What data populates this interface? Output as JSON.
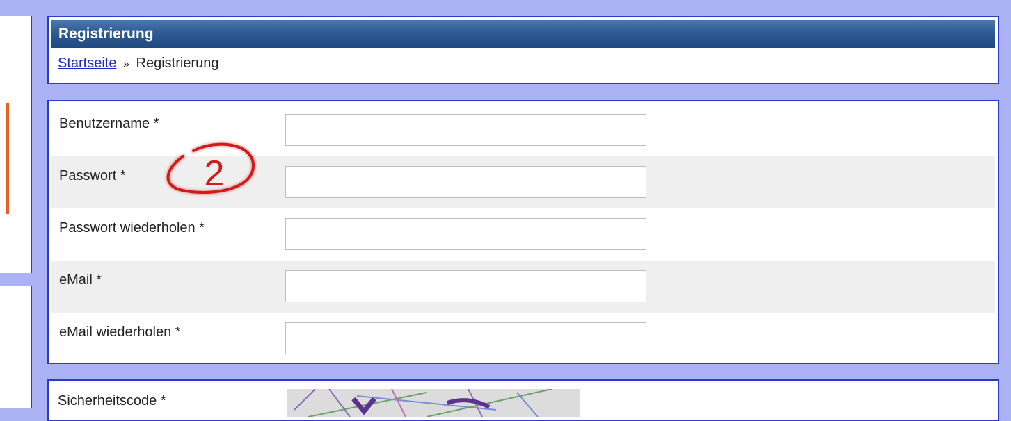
{
  "header": {
    "title": "Registrierung",
    "breadcrumb": {
      "home_link": "Startseite",
      "separator": "»",
      "current": "Registrierung"
    }
  },
  "form": {
    "fields": [
      {
        "label": "Benutzername *",
        "value": "",
        "type": "text"
      },
      {
        "label": "Passwort *",
        "value": "",
        "type": "password"
      },
      {
        "label": "Passwort wiederholen *",
        "value": "",
        "type": "password"
      },
      {
        "label": "eMail *",
        "value": "",
        "type": "text"
      },
      {
        "label": "eMail wiederholen *",
        "value": "",
        "type": "text"
      }
    ]
  },
  "annotation": {
    "number": "2",
    "color": "#d11a1a"
  },
  "captcha": {
    "label": "Sicherheitscode *"
  },
  "colors": {
    "page_background": "#aab2f4",
    "panel_border": "#2b3bc9",
    "titlebar": "#2f5b93",
    "link": "#1b2ac6",
    "sidebar_accent": "#e8611f",
    "alt_row": "#efefef"
  }
}
